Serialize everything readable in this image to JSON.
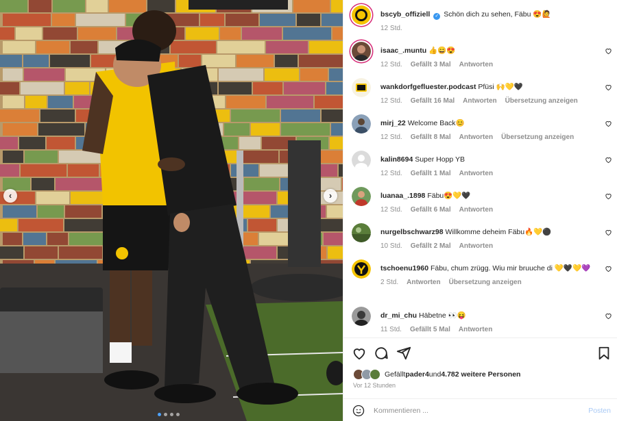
{
  "photo": {
    "prev_label": "‹",
    "next_label": "›",
    "carousel": {
      "count": 4,
      "active_index": 0
    }
  },
  "post": {
    "author": "bscyb_offiziell",
    "caption": "Schön dich zu sehen, Fäbu 😍🙋",
    "time": "12 Std."
  },
  "comments": [
    {
      "user": "isaac_.muntu",
      "text": "👍😄😍",
      "time": "12 Std.",
      "likes": "Gefällt 3 Mal",
      "reply": "Antworten",
      "translate": ""
    },
    {
      "user": "wankdorfgefluester.podcast",
      "text": "Pfüsi 🙌💛🖤",
      "time": "12 Std.",
      "likes": "Gefällt 16 Mal",
      "reply": "Antworten",
      "translate": "Übersetzung anzeigen"
    },
    {
      "user": "mirj_22",
      "text": "Welcome Back😊",
      "time": "12 Std.",
      "likes": "Gefällt 8 Mal",
      "reply": "Antworten",
      "translate": "Übersetzung anzeigen"
    },
    {
      "user": "kalin8694",
      "text": "Super Hopp YB",
      "time": "12 Std.",
      "likes": "Gefällt 1 Mal",
      "reply": "Antworten",
      "translate": ""
    },
    {
      "user": "luanaa_.1898",
      "text": "Fäbu😍💛🖤",
      "time": "12 Std.",
      "likes": "Gefällt 6 Mal",
      "reply": "Antworten",
      "translate": ""
    },
    {
      "user": "nurgelbschwarz98",
      "text": "Willkomme deheim Fäbu🔥💛⚫",
      "time": "10 Std.",
      "likes": "Gefällt 2 Mal",
      "reply": "Antworten",
      "translate": ""
    },
    {
      "user": "tschoenu1960",
      "text": "Fäbu, chum zrügg. Wiu mir bruuche di 💛🖤💛💜",
      "time": "2 Std.",
      "likes": "",
      "reply": "Antworten",
      "translate": "Übersetzung anzeigen"
    },
    {
      "user": "dr_mi_chu",
      "text": "Häbetne 👀😝",
      "time": "11 Std.",
      "likes": "Gefällt 5 Mal",
      "reply": "Antworten",
      "translate": ""
    }
  ],
  "likes": {
    "prefix": "Gefällt ",
    "user": "pader4",
    "middle": " und ",
    "count": "4.782 weitere Personen"
  },
  "posted_ago": "Vor 12 Stunden",
  "composer": {
    "placeholder": "Kommentieren ...",
    "post_label": "Posten"
  },
  "colors": {
    "yb_yellow": "#f5c400",
    "link_blue": "#0095f6",
    "post_disabled": "#a8c9f5",
    "meta_gray": "#8e8e8e"
  },
  "icons": [
    "heart-icon",
    "comment-icon",
    "share-icon",
    "bookmark-icon",
    "emoji-icon",
    "verified-icon",
    "yb-logo-icon"
  ]
}
